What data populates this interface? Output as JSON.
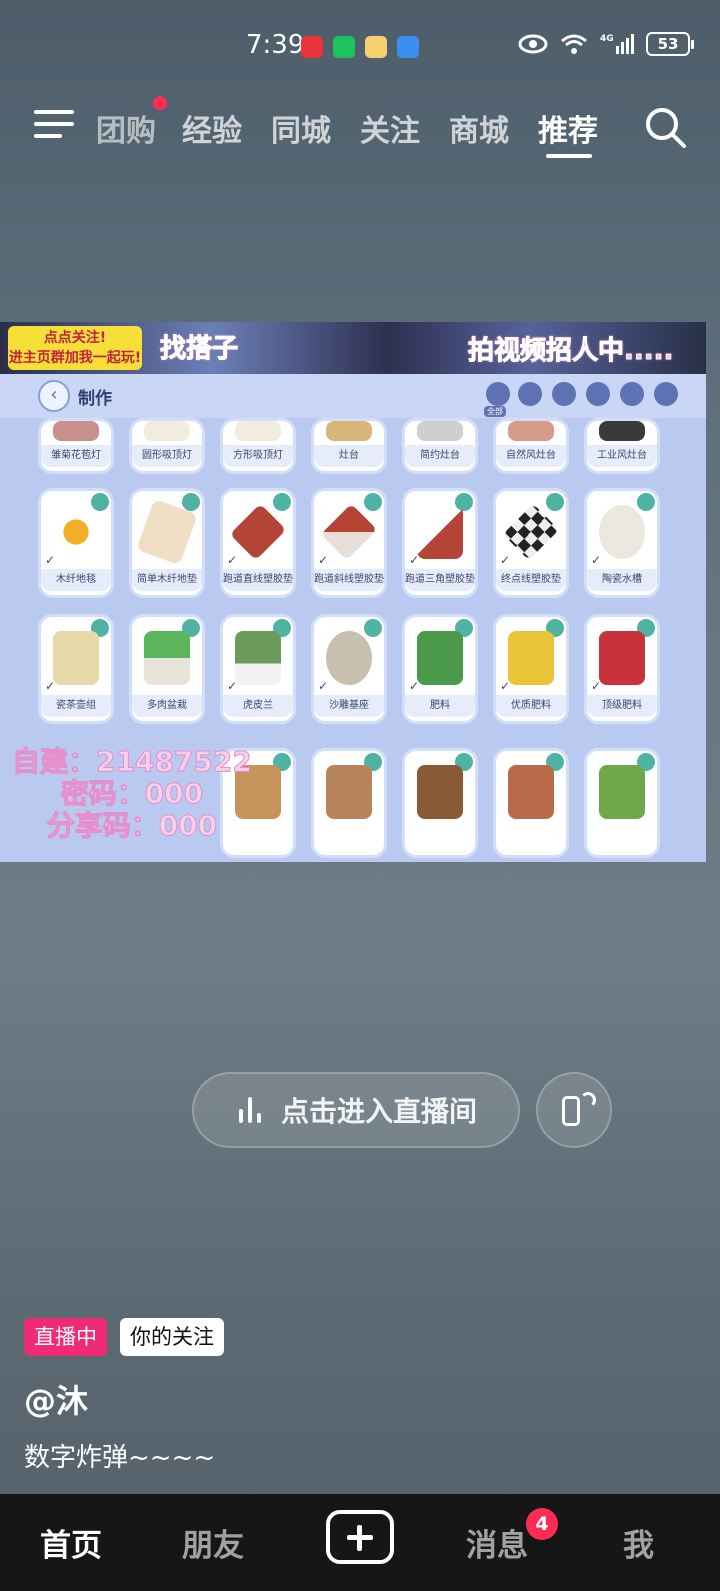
{
  "status": {
    "time": "7:39",
    "battery": "53",
    "network": "4G"
  },
  "nav": {
    "tabs": [
      "团购",
      "经验",
      "同城",
      "关注",
      "商城",
      "推荐"
    ],
    "active_tab": "推荐"
  },
  "video": {
    "banner_text": "点点关注!\n进主页群加我一起玩!",
    "overlay_find_partner": "找搭子",
    "overlay_recruit": "拍视频招人中.....",
    "game_title": "制作",
    "category_label": "全部",
    "room_info_line1": "自建：21487522",
    "room_info_line2": "密码：000",
    "room_info_line3": "分享码：000",
    "items_row0": [
      "雏菊花苞灯",
      "圆形吸顶灯",
      "方形吸顶灯",
      "灶台",
      "简约灶台",
      "自然风灶台",
      "工业风灶台"
    ],
    "items_row1": [
      "木纤地毯",
      "简单木纤地垫",
      "跑道直线塑胶垫",
      "跑道斜线塑胶垫",
      "跑道三角塑胶垫",
      "终点线塑胶垫",
      "陶瓷水槽"
    ],
    "items_row2": [
      "瓷茶壶组",
      "多肉盆栽",
      "虎皮兰",
      "沙雕基座",
      "肥料",
      "优质肥料",
      "顶级肥料"
    ]
  },
  "live": {
    "enter_label": "点击进入直播间",
    "badge_live": "直播中",
    "badge_follow": "你的关注",
    "author": "@沐",
    "description": "数字炸弹~~~~"
  },
  "tabbar": {
    "home": "首页",
    "friends": "朋友",
    "messages": "消息",
    "messages_badge": "4",
    "me": "我"
  },
  "colors": {
    "live_badge": "#f02b76",
    "notification": "#fe2c55"
  }
}
